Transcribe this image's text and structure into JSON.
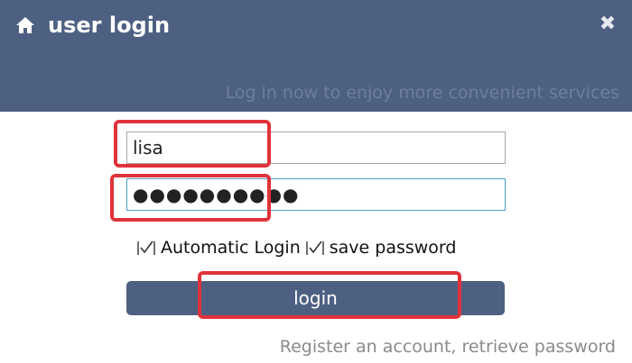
{
  "window": {
    "title": "user login",
    "close_symbol": "✖",
    "subtitle": "Log in now to enjoy more convenient services"
  },
  "form": {
    "username_value": "lisa",
    "password_value": "●●●●●●●●●●",
    "options": [
      {
        "label": "Automatic Login",
        "checked": true
      },
      {
        "label": "save password",
        "checked": true
      }
    ],
    "login_label": "login"
  },
  "footer": {
    "links_text": "Register an account, retrieve password"
  },
  "icons": [
    "home-icon",
    "close-icon",
    "checkbox-icon"
  ],
  "colors": {
    "header_bg": "#4e6082",
    "button_bg": "#4e6082",
    "highlight": "#e0323a",
    "focus_border": "#4aa3c8"
  }
}
